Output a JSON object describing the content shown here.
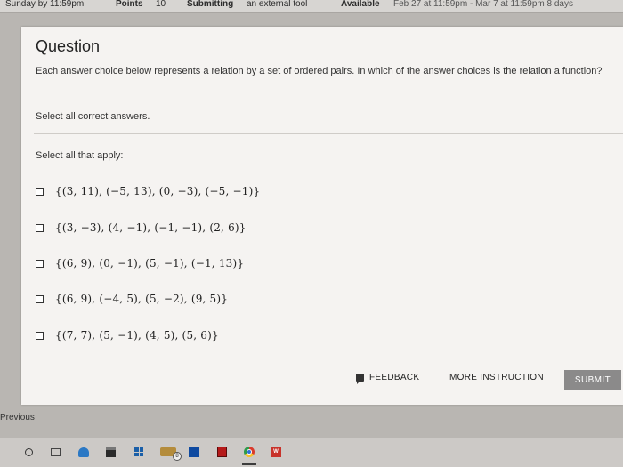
{
  "topbar": {
    "due": "Sunday by 11:59pm",
    "points_label": "Points",
    "points_value": "10",
    "submitting_label": "Submitting",
    "submitting_value": "an external tool",
    "available_label": "Available",
    "available_value": "Feb 27 at 11:59pm - Mar 7 at 11:59pm 8 days"
  },
  "question": {
    "title": "Question",
    "text": "Each answer choice below represents a relation by a set of ordered pairs. In which of the answer choices is the relation a function?",
    "instruction": "Select all correct answers.",
    "apply_label": "Select all that apply:",
    "choices": [
      {
        "label": "{(3, 11), (−5, 13), (0, −3), (−5, −1)}",
        "checked": false
      },
      {
        "label": "{(3, −3), (4, −1), (−1, −1), (2, 6)}",
        "checked": false
      },
      {
        "label": "{(6, 9), (0, −1), (5, −1), (−1, 13)}",
        "checked": false
      },
      {
        "label": "{(6, 9), (−4, 5), (5, −2), (9, 5)}",
        "checked": false
      },
      {
        "label": "{(7, 7), (5, −1), (4, 5), (5, 6)}",
        "checked": false
      }
    ]
  },
  "actions": {
    "feedback": "FEEDBACK",
    "more_instruction": "MORE INSTRUCTION",
    "submit": "SUBMIT"
  },
  "nav": {
    "previous": "Previous"
  },
  "taskbar": {
    "files_badge": "8",
    "word_letter": "W",
    "icons": [
      "search-icon",
      "task-view-icon",
      "edge-icon",
      "store-icon",
      "windows-icon",
      "file-explorer-icon",
      "mail-icon",
      "red-app-icon",
      "chrome-icon",
      "word-icon"
    ]
  }
}
